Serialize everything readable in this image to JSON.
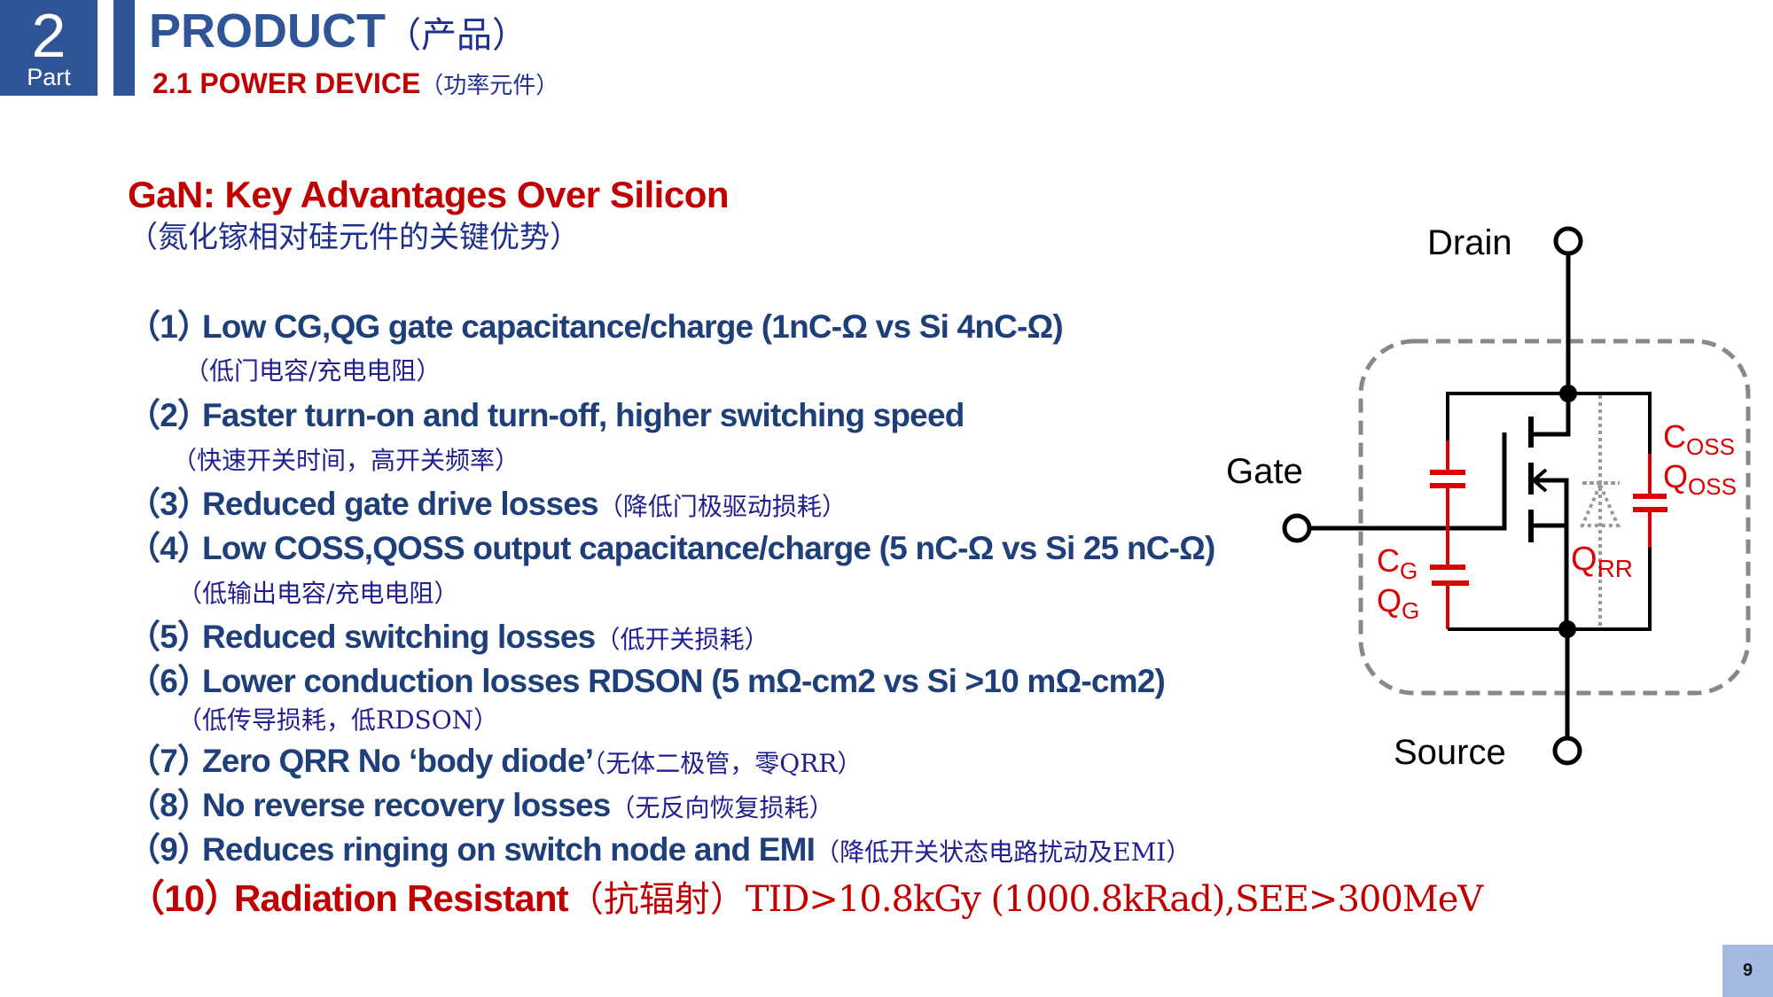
{
  "header": {
    "part_number": "2",
    "part_label": "Part",
    "title": "PRODUCT",
    "title_cn": "（产品）",
    "subtitle": "2.1 POWER DEVICE",
    "subtitle_cn": "（功率元件）"
  },
  "content": {
    "heading": "GaN: Key Advantages Over Silicon",
    "heading_cn": "（氮化镓相对硅元件的关键优势）",
    "items": [
      {
        "num": "（1）",
        "text": "Low CG,QG gate capacitance/charge (1nC-Ω vs Si 4nC-Ω)",
        "cn_inline": "",
        "cn_sub": "（低门电容/充电电阻）"
      },
      {
        "num": "（2）",
        "text": "Faster turn-on and turn-off, higher switching speed",
        "cn_inline": "",
        "cn_sub": "（快速开关时间，高开关频率）"
      },
      {
        "num": "（3）",
        "text": "Reduced gate drive losses",
        "cn_inline": "（降低门极驱动损耗）",
        "cn_sub": ""
      },
      {
        "num": "（4）",
        "text": "Low COSS,QOSS  output capacitance/charge (5 nC-Ω vs Si 25 nC-Ω)",
        "cn_inline": "",
        "cn_sub": "（低输出电容/充电电阻）"
      },
      {
        "num": "（5）",
        "text": "Reduced switching losses",
        "cn_inline": "（低开关损耗）",
        "cn_sub": ""
      },
      {
        "num": "（6）",
        "text": "Lower conduction losses RDSON (5 mΩ-cm2 vs Si >10 mΩ-cm2)",
        "cn_inline": "",
        "cn_sub": "（低传导损耗，低RDSON）"
      },
      {
        "num": "（7）",
        "text": "Zero QRR No ‘body diode’",
        "cn_inline": "（无体二极管，零QRR）",
        "cn_sub": ""
      },
      {
        "num": "（8）",
        "text": "No reverse recovery losses",
        "cn_inline": "（无反向恢复损耗）",
        "cn_sub": ""
      },
      {
        "num": "（9）",
        "text": "Reduces ringing on switch node and EMI",
        "cn_inline": "（降低开关状态电路扰动及EMI）",
        "cn_sub": ""
      },
      {
        "num": "（10）",
        "text": "Radiation Resistant",
        "cn_inline": "（抗辐射）",
        "spec": "TID>10.8kGy (1000.8kRad),SEE>300MeV"
      }
    ]
  },
  "diagram": {
    "drain": "Drain",
    "gate": "Gate",
    "source": "Source",
    "cg_main": "C",
    "cg_sub": "G",
    "qg_main": "Q",
    "qg_sub": "G",
    "coss_main": "C",
    "coss_sub": "OSS",
    "qoss_main": "Q",
    "qoss_sub": "OSS",
    "qrr_main": "Q",
    "qrr_sub": "RR",
    "colors": {
      "wire": "#000000",
      "parasitic": "#dd0000",
      "boundary": "#888888",
      "diode": "#999999"
    }
  },
  "footer": {
    "page_number": "9"
  }
}
